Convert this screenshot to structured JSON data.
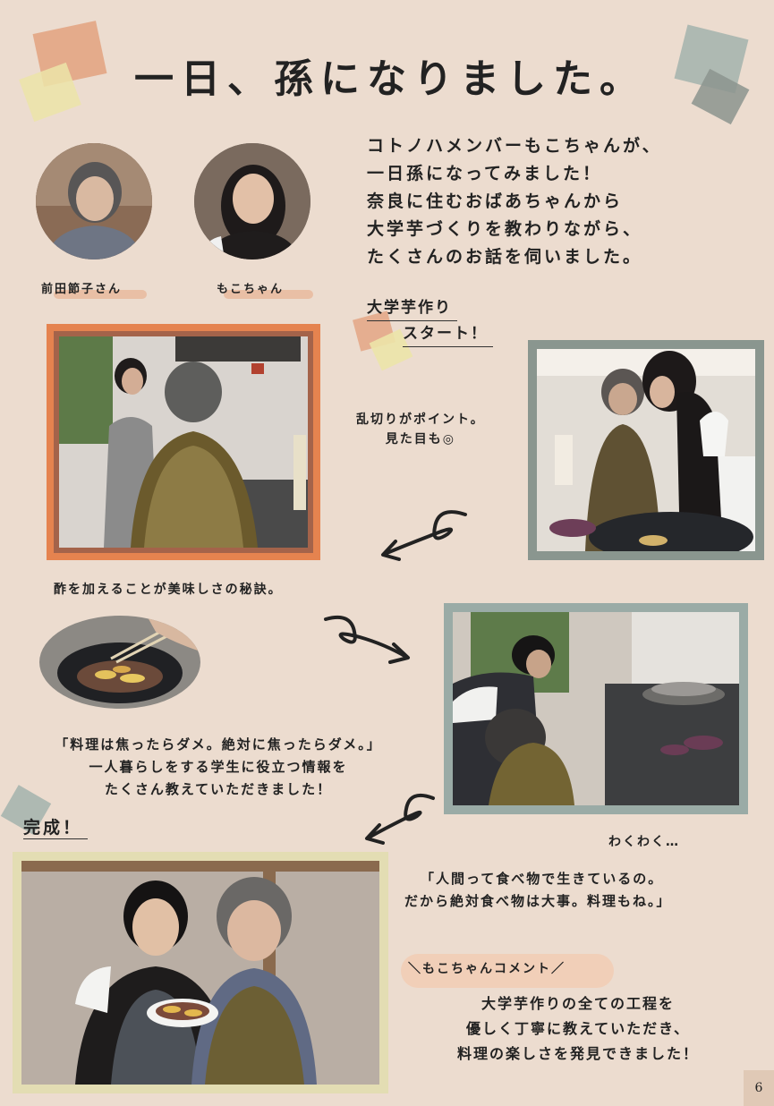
{
  "title": "一日、孫になりました。",
  "intro": {
    "line1": "コトノハメンバーもこちゃんが、",
    "line2": "一日孫になってみました！",
    "line3": "奈良に住むおばあちゃんから",
    "line4": "大学芋づくりを教わりながら、",
    "line5": "たくさんのお話を伺いました。"
  },
  "people": {
    "grandma": "前田節子さん",
    "moko": "もこちゃん"
  },
  "section_start": {
    "line1": "大学芋作り",
    "line2": "スタート！"
  },
  "notes": {
    "cut": "乱切りがポイント。",
    "cut2": "見た目も◎",
    "vinegar": "酢を加えることが美味しさの秘訣。",
    "wakuwaku": "わくわく…"
  },
  "quote1": {
    "line1": "「料理は焦ったらダメ。絶対に焦ったらダメ。」",
    "line2": "一人暮らしをする学生に役立つ情報を",
    "line3": "たくさん教えていただきました！"
  },
  "complete": "完成！",
  "quote2": {
    "line1": "「人間って食べ物で生きているの。",
    "line2": "だから絶対食べ物は大事。料理もね。」"
  },
  "comment": {
    "heading": "＼もこちゃんコメント／",
    "line1": "大学芋作りの全ての工程を",
    "line2": "優しく丁寧に教えていただき、",
    "line3": "料理の楽しさを発見できました！"
  },
  "page_number": "6",
  "colors": {
    "page": "#ecdccf",
    "accent_orange": "#e38a5e",
    "accent_teal": "#8fa39c",
    "highlight_peach": "#e8b89a",
    "accent_yellow": "#ece4a8"
  }
}
